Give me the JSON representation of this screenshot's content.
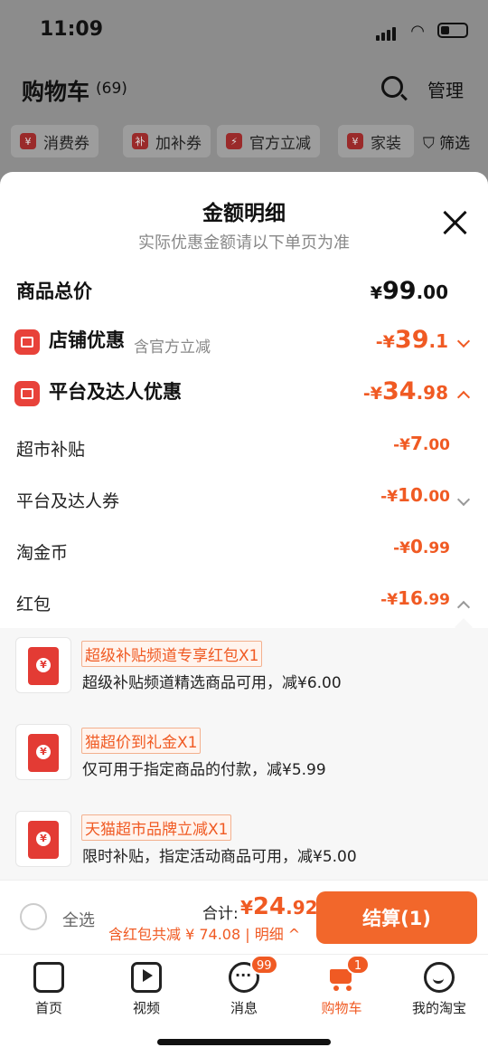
{
  "status": {
    "time": "11:09"
  },
  "cart": {
    "title": "购物车",
    "count": "(69)",
    "manage": "管理"
  },
  "chips": [
    {
      "icon": "¥",
      "label": "消费券"
    },
    {
      "icon": "补",
      "label": "加补券"
    },
    {
      "icon": "⚡",
      "label": "官方立减"
    },
    {
      "icon": "¥",
      "label": "家装"
    }
  ],
  "filter": "筛选",
  "sheet": {
    "title": "金额明细",
    "subtitle": "实际优惠金额请以下单页为准",
    "total": {
      "label": "商品总价",
      "cur": "¥",
      "int": "99",
      "dec": ".00"
    },
    "shop": {
      "label": "店铺优惠",
      "note": "含官方立减",
      "cur": "-¥",
      "int": "39",
      "dec": ".1"
    },
    "platform": {
      "label": "平台及达人优惠",
      "cur": "-¥",
      "int": "34",
      "dec": ".98"
    },
    "items": [
      {
        "label": "超市补贴",
        "cur": "-¥",
        "int": "7",
        "dec": ".00"
      },
      {
        "label": "平台及达人券",
        "cur": "-¥",
        "int": "10",
        "dec": ".00"
      },
      {
        "label": "淘金币",
        "cur": "-¥",
        "int": "0",
        "dec": ".99"
      },
      {
        "label": "红包",
        "cur": "-¥",
        "int": "16",
        "dec": ".99"
      }
    ],
    "coupons": [
      {
        "tag": "超级补贴频道专享红包X1",
        "desc": "超级补贴频道精选商品可用，减¥6.00"
      },
      {
        "tag": "猫超价到礼金X1",
        "desc": "仅可用于指定商品的付款，减¥5.99"
      },
      {
        "tag": "天猫超市品牌立减X1",
        "desc": "限时补贴，指定活动商品可用，减¥5.00"
      }
    ]
  },
  "bottom": {
    "select_all": "全选",
    "total_label": "合计:",
    "total_cur": "¥",
    "total_int": "24",
    "total_dec": ".92",
    "save_line": "含红包共减 ¥ 74.08 | 明细 ^",
    "checkout": "结算(1)"
  },
  "tabs": [
    {
      "label": "首页",
      "icon": "home-icon"
    },
    {
      "label": "视频",
      "icon": "video-icon"
    },
    {
      "label": "消息",
      "icon": "message-icon",
      "badge": "99"
    },
    {
      "label": "购物车",
      "icon": "cart-icon",
      "badge": "1"
    },
    {
      "label": "我的淘宝",
      "icon": "profile-icon"
    }
  ],
  "colors": {
    "accent": "#f05a23",
    "red": "#e33b34"
  }
}
